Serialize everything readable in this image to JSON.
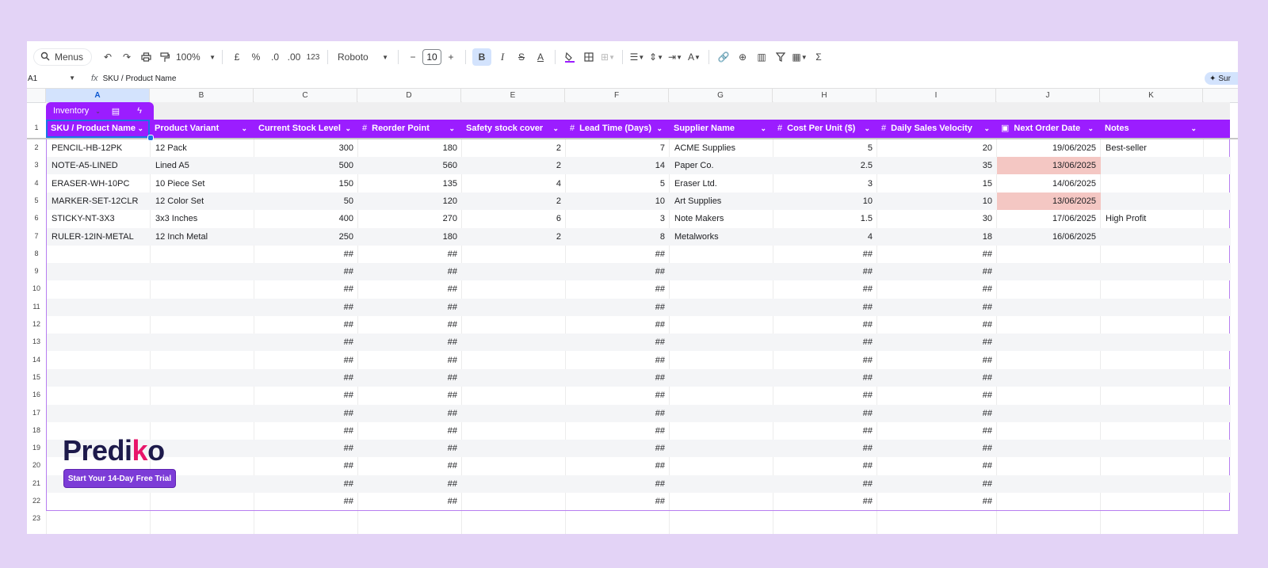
{
  "toolbar": {
    "menus_label": "Menus",
    "zoom": "100%",
    "currency": "£",
    "percent": "%",
    "dec_decrease": ".0",
    "dec_increase": ".00",
    "number_format": "123",
    "font": "Roboto",
    "font_size": "10",
    "bold": "B",
    "italic": "I",
    "text_color": "A",
    "sum": "Σ"
  },
  "formula_bar": {
    "cell_ref": "A1",
    "fx": "fx",
    "content": "SKU / Product Name",
    "summary_label": "Sur"
  },
  "columns": [
    "A",
    "B",
    "C",
    "D",
    "E",
    "F",
    "G",
    "H",
    "I",
    "J",
    "K"
  ],
  "table": {
    "name": "Inventory",
    "headers": [
      "SKU / Product Name",
      "Product Variant",
      "Current Stock Level",
      "Reorder Point",
      "Safety stock cover",
      "Lead Time (Days)",
      "Supplier Name",
      "Cost Per Unit ($)",
      "Daily Sales Velocity",
      "Next Order Date",
      "Notes"
    ],
    "rows": [
      [
        "PENCIL-HB-12PK",
        "12 Pack",
        "300",
        "180",
        "2",
        "7",
        "ACME Supplies",
        "5",
        "20",
        "19/06/2025",
        "Best-seller"
      ],
      [
        "NOTE-A5-LINED",
        "Lined A5",
        "500",
        "560",
        "2",
        "14",
        "Paper Co.",
        "2.5",
        "35",
        "13/06/2025",
        ""
      ],
      [
        "ERASER-WH-10PC",
        "10 Piece Set",
        "150",
        "135",
        "4",
        "5",
        "Eraser Ltd.",
        "3",
        "15",
        "14/06/2025",
        ""
      ],
      [
        "MARKER-SET-12CLR",
        "12 Color Set",
        "50",
        "120",
        "2",
        "10",
        "Art Supplies",
        "10",
        "10",
        "13/06/2025",
        ""
      ],
      [
        "STICKY-NT-3X3",
        "3x3 Inches",
        "400",
        "270",
        "6",
        "3",
        "Note Makers",
        "1.5",
        "30",
        "17/06/2025",
        "High Profit"
      ],
      [
        "RULER-12IN-METAL",
        "12 Inch Metal",
        "250",
        "180",
        "2",
        "8",
        "Metalworks",
        "4",
        "18",
        "16/06/2025",
        ""
      ]
    ],
    "overflow_marker": "##",
    "row_numbers": [
      "1",
      "2",
      "3",
      "4",
      "5",
      "6",
      "7",
      "8",
      "9",
      "10",
      "11",
      "12",
      "13",
      "14",
      "15",
      "16",
      "17",
      "18",
      "19",
      "20",
      "21",
      "22",
      "23"
    ]
  },
  "brand": {
    "logo_left": "Predi",
    "logo_accent": "k",
    "logo_right": "o",
    "cta": "Start Your 14-Day Free Trial"
  },
  "colors": {
    "header": "#9b1dff",
    "due_highlight": "#f4c7c3",
    "background": "#e3d3f6",
    "cta": "#7c3cd7",
    "logo_accent": "#e8156a"
  }
}
